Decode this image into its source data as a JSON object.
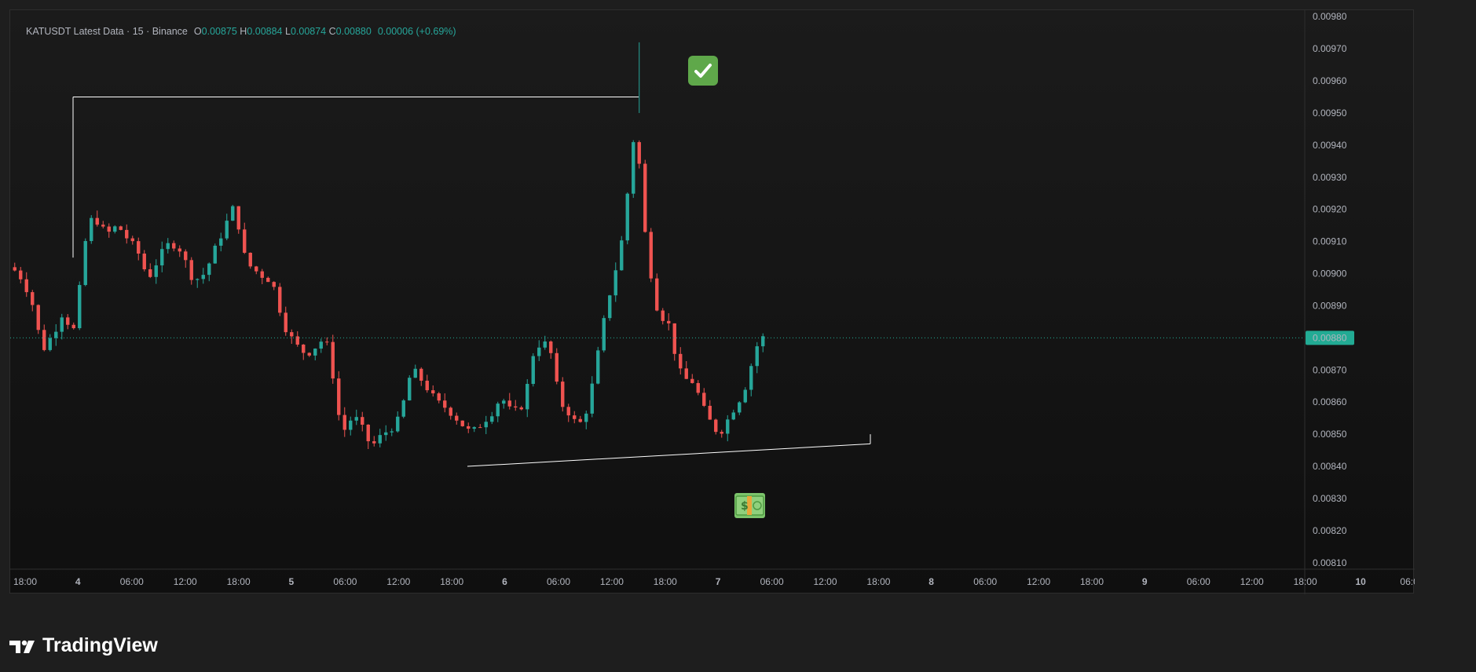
{
  "legend": {
    "symbol": "KATUSDT Latest Data · 15 · Binance",
    "open_label": "O",
    "open": "0.00875",
    "high_label": "H",
    "high": "0.00884",
    "low_label": "L",
    "low": "0.00874",
    "close_label": "C",
    "close": "0.00880",
    "change": "0.00006 (+0.69%)"
  },
  "brand": {
    "name": "TradingView"
  },
  "price_tag": "0.00880",
  "colors": {
    "up": "#26a69a",
    "down": "#ef5350",
    "tag": "#22ab94",
    "line": "#ffffff"
  },
  "icons": {
    "target": "check-mark-icon",
    "money": "dollar-banknote-icon"
  },
  "chart_data": {
    "type": "candlestick",
    "timeframe": "15",
    "x_axis_labels": [
      "18:00",
      "4",
      "06:00",
      "12:00",
      "18:00",
      "5",
      "06:00",
      "12:00",
      "18:00",
      "6",
      "06:00",
      "12:00",
      "18:00",
      "7",
      "06:00",
      "12:00",
      "18:00",
      "8",
      "06:00",
      "12:00",
      "18:00",
      "9",
      "06:00",
      "12:00",
      "18:00",
      "10",
      "06:0"
    ],
    "y_axis_labels": [
      "0.00980",
      "0.00970",
      "0.00960",
      "0.00950",
      "0.00940",
      "0.00930",
      "0.00920",
      "0.00910",
      "0.00900",
      "0.00890",
      "0.00870",
      "0.00860",
      "0.00850",
      "0.00840",
      "0.00830",
      "0.00820",
      "0.00810"
    ],
    "ylim": [
      0.00808,
      0.00982
    ],
    "last_price": 0.0088,
    "price_path": [
      [
        0,
        0.00902
      ],
      [
        2,
        0.00898
      ],
      [
        4,
        0.00888
      ],
      [
        5,
        0.00876
      ],
      [
        6,
        0.00878
      ],
      [
        8,
        0.00885
      ],
      [
        9,
        0.0089
      ],
      [
        10,
        0.0088
      ],
      [
        11,
        0.00885
      ],
      [
        12,
        0.00905
      ],
      [
        13,
        0.00915
      ],
      [
        14,
        0.00918
      ],
      [
        16,
        0.00912
      ],
      [
        18,
        0.00915
      ],
      [
        20,
        0.0091
      ],
      [
        22,
        0.00905
      ],
      [
        23,
        0.00898
      ],
      [
        25,
        0.00905
      ],
      [
        27,
        0.0091
      ],
      [
        29,
        0.00907
      ],
      [
        30,
        0.009
      ],
      [
        32,
        0.00898
      ],
      [
        34,
        0.00905
      ],
      [
        35,
        0.0091
      ],
      [
        37,
        0.00918
      ],
      [
        38,
        0.00922
      ],
      [
        39,
        0.00908
      ],
      [
        40,
        0.00903
      ],
      [
        42,
        0.009
      ],
      [
        44,
        0.00898
      ],
      [
        45,
        0.00893
      ],
      [
        46,
        0.00885
      ],
      [
        48,
        0.00878
      ],
      [
        50,
        0.00875
      ],
      [
        52,
        0.00878
      ],
      [
        53,
        0.0088
      ],
      [
        54,
        0.00875
      ],
      [
        55,
        0.00862
      ],
      [
        56,
        0.0085
      ],
      [
        58,
        0.00856
      ],
      [
        60,
        0.0085
      ],
      [
        61,
        0.00846
      ],
      [
        63,
        0.0085
      ],
      [
        65,
        0.00853
      ],
      [
        66,
        0.00855
      ],
      [
        67,
        0.00865
      ],
      [
        68,
        0.0087
      ],
      [
        70,
        0.00866
      ],
      [
        72,
        0.0086
      ],
      [
        74,
        0.00858
      ],
      [
        76,
        0.00854
      ],
      [
        78,
        0.0085
      ],
      [
        80,
        0.00854
      ],
      [
        82,
        0.00858
      ],
      [
        83,
        0.00862
      ],
      [
        85,
        0.00856
      ],
      [
        87,
        0.0086
      ],
      [
        88,
        0.0087
      ],
      [
        89,
        0.0088
      ],
      [
        90,
        0.00876
      ],
      [
        91,
        0.0088
      ],
      [
        92,
        0.0087
      ],
      [
        93,
        0.0086
      ],
      [
        95,
        0.00856
      ],
      [
        96,
        0.00852
      ],
      [
        97,
        0.00855
      ],
      [
        98,
        0.0086
      ],
      [
        99,
        0.0087
      ],
      [
        100,
        0.0088
      ],
      [
        101,
        0.0089
      ],
      [
        102,
        0.00898
      ],
      [
        103,
        0.00905
      ],
      [
        104,
        0.00915
      ],
      [
        105,
        0.00935
      ],
      [
        106,
        0.00948
      ],
      [
        107,
        0.0092
      ],
      [
        108,
        0.00905
      ],
      [
        109,
        0.00895
      ],
      [
        110,
        0.00885
      ],
      [
        111,
        0.00888
      ],
      [
        112,
        0.0088
      ],
      [
        113,
        0.00872
      ],
      [
        114,
        0.00866
      ],
      [
        115,
        0.00868
      ],
      [
        116,
        0.00865
      ],
      [
        117,
        0.0086
      ],
      [
        118,
        0.00855
      ],
      [
        119,
        0.00853
      ],
      [
        120,
        0.0085
      ],
      [
        121,
        0.00853
      ],
      [
        122,
        0.00856
      ],
      [
        123,
        0.0086
      ],
      [
        124,
        0.00862
      ],
      [
        125,
        0.00868
      ],
      [
        126,
        0.00875
      ],
      [
        127,
        0.0088
      ]
    ],
    "annotations": [
      {
        "type": "horizontal_level",
        "price": 0.00955,
        "note": "top line from start to spike"
      },
      {
        "type": "trend_line",
        "from_price": 0.0084,
        "to_price": 0.00847
      }
    ]
  }
}
